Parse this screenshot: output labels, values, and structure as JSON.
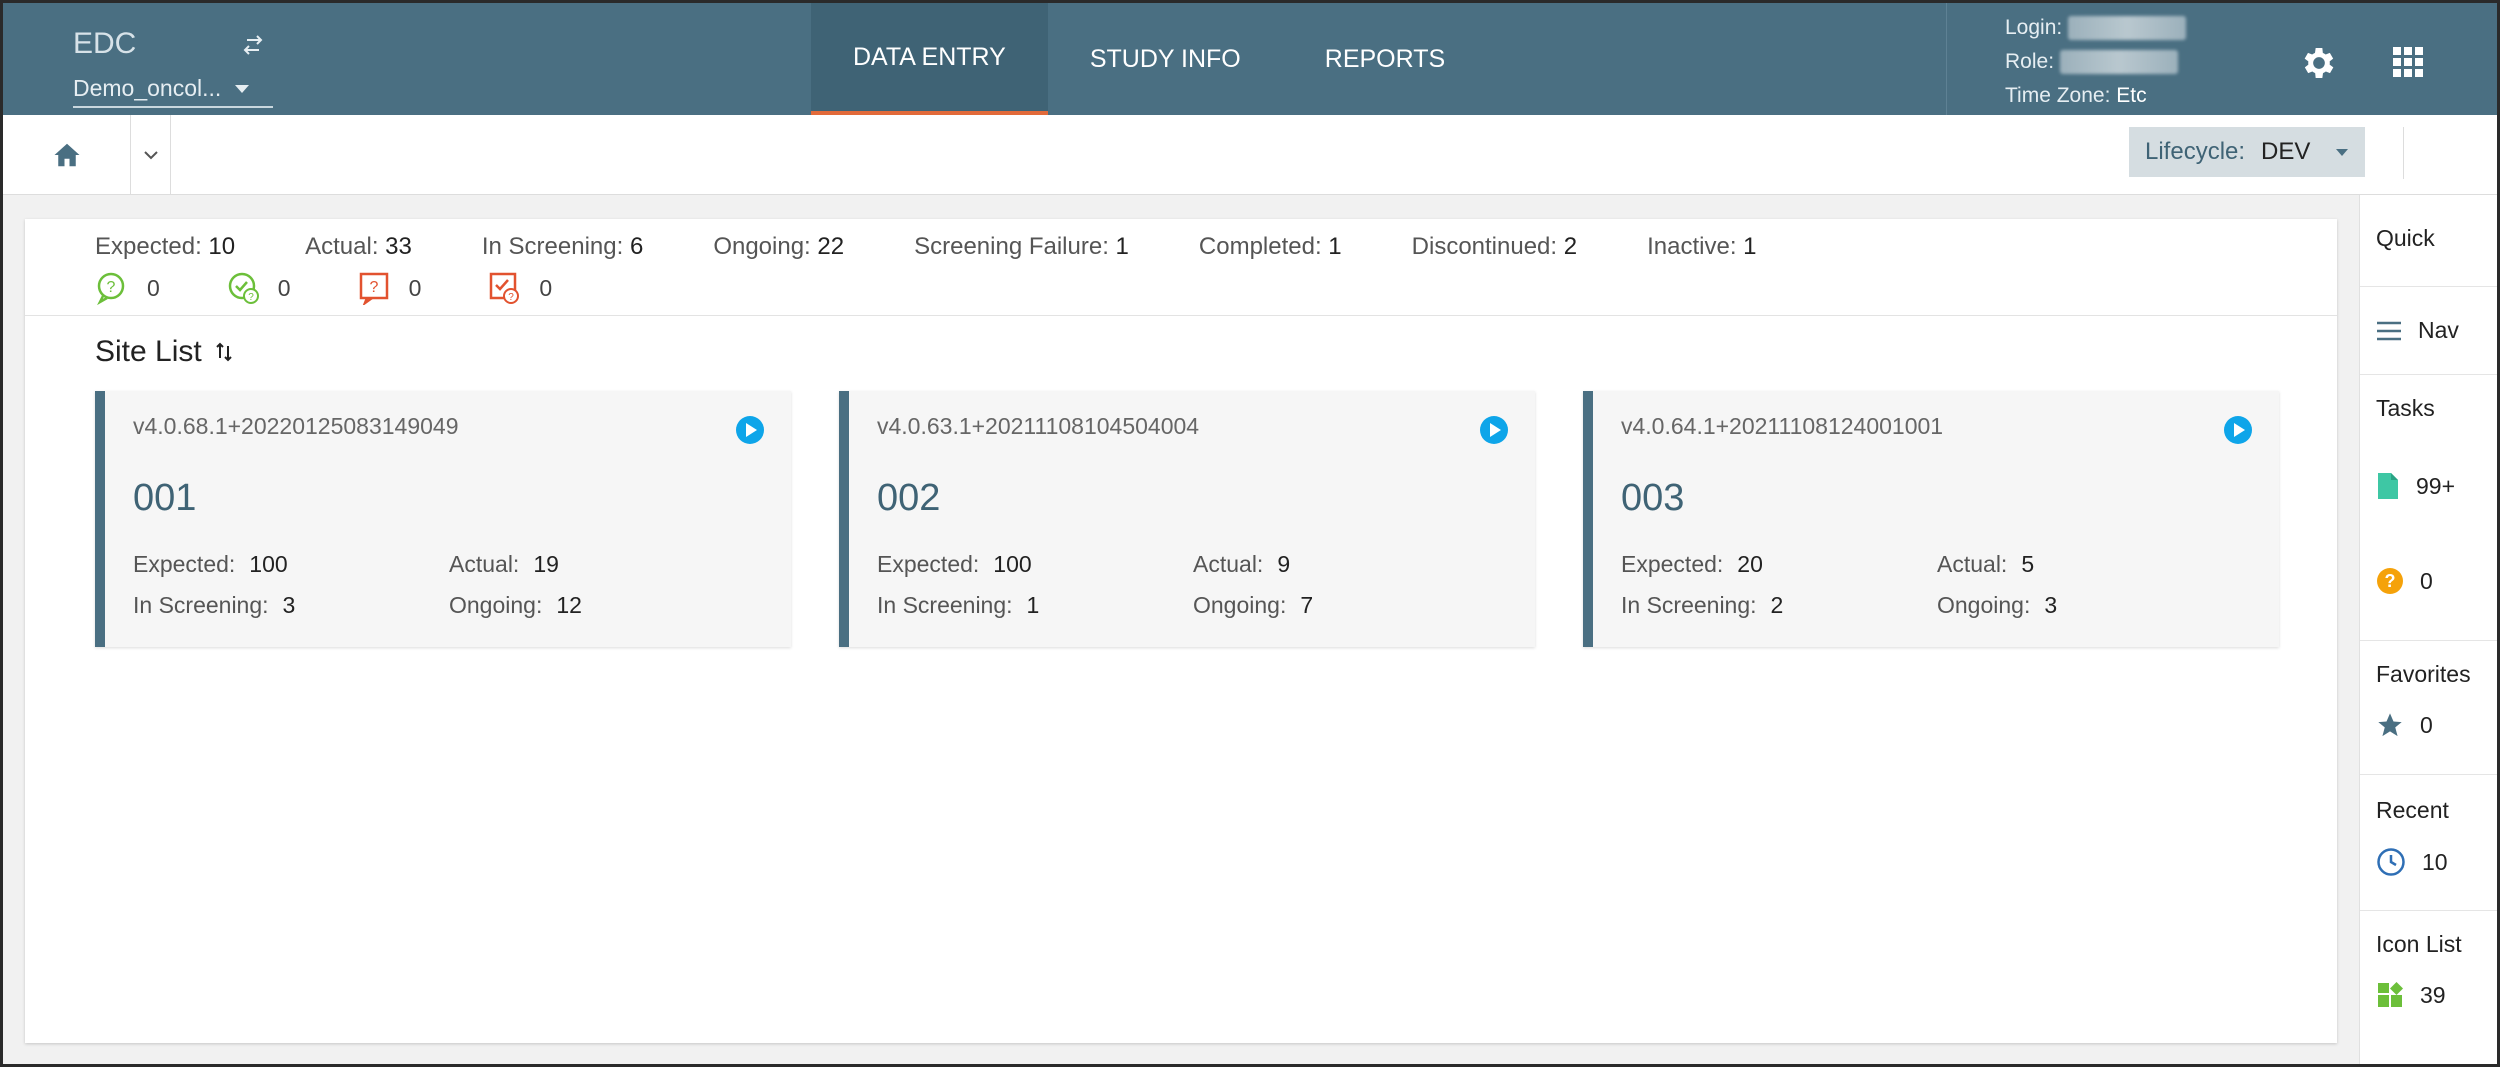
{
  "header": {
    "app_name": "EDC",
    "study": "Demo_oncol...",
    "tabs": [
      {
        "label": "DATA ENTRY",
        "active": true
      },
      {
        "label": "STUDY INFO",
        "active": false
      },
      {
        "label": "REPORTS",
        "active": false
      }
    ],
    "login_label": "Login:",
    "role_label": "Role:",
    "timezone_label": "Time Zone:",
    "timezone_value": "Etc"
  },
  "subbar": {
    "lifecycle_label": "Lifecycle:",
    "lifecycle_value": "DEV"
  },
  "summary": {
    "expected": {
      "label": "Expected:",
      "value": "10"
    },
    "actual": {
      "label": "Actual:",
      "value": "33"
    },
    "in_screening": {
      "label": "In Screening:",
      "value": "6"
    },
    "ongoing": {
      "label": "Ongoing:",
      "value": "22"
    },
    "screening_failure": {
      "label": "Screening Failure:",
      "value": "1"
    },
    "completed": {
      "label": "Completed:",
      "value": "1"
    },
    "discontinued": {
      "label": "Discontinued:",
      "value": "2"
    },
    "inactive": {
      "label": "Inactive:",
      "value": "1"
    },
    "queries": {
      "open": "0",
      "answered": "0",
      "new": "0",
      "review": "0"
    }
  },
  "site_list": {
    "title": "Site List",
    "sites": [
      {
        "version": "v4.0.68.1+20220125083149049",
        "number": "001",
        "expected": "100",
        "actual": "19",
        "in_screening": "3",
        "ongoing": "12"
      },
      {
        "version": "v4.0.63.1+20211108104504004",
        "number": "002",
        "expected": "100",
        "actual": "9",
        "in_screening": "1",
        "ongoing": "7"
      },
      {
        "version": "v4.0.64.1+20211108124001001",
        "number": "003",
        "expected": "20",
        "actual": "5",
        "in_screening": "2",
        "ongoing": "3"
      }
    ],
    "labels": {
      "expected": "Expected:",
      "actual": "Actual:",
      "in_screening": "In Screening:",
      "ongoing": "Ongoing:"
    }
  },
  "quick": {
    "title": "Quick",
    "nav_label": "Nav",
    "tasks_label": "Tasks",
    "tasks_count": "99+",
    "queries_count": "0",
    "favorites_label": "Favorites",
    "favorites_count": "0",
    "recent_label": "Recent",
    "recent_count": "10",
    "icon_list_label": "Icon List",
    "icon_list_count": "39"
  },
  "colors": {
    "header_bg": "#4a6f82",
    "active_tab_underline": "#e26a3a",
    "card_accent": "#4a6f82",
    "play_icon": "#0ea5e9",
    "query_green": "#6cbf3a",
    "query_red": "#e2522f"
  }
}
